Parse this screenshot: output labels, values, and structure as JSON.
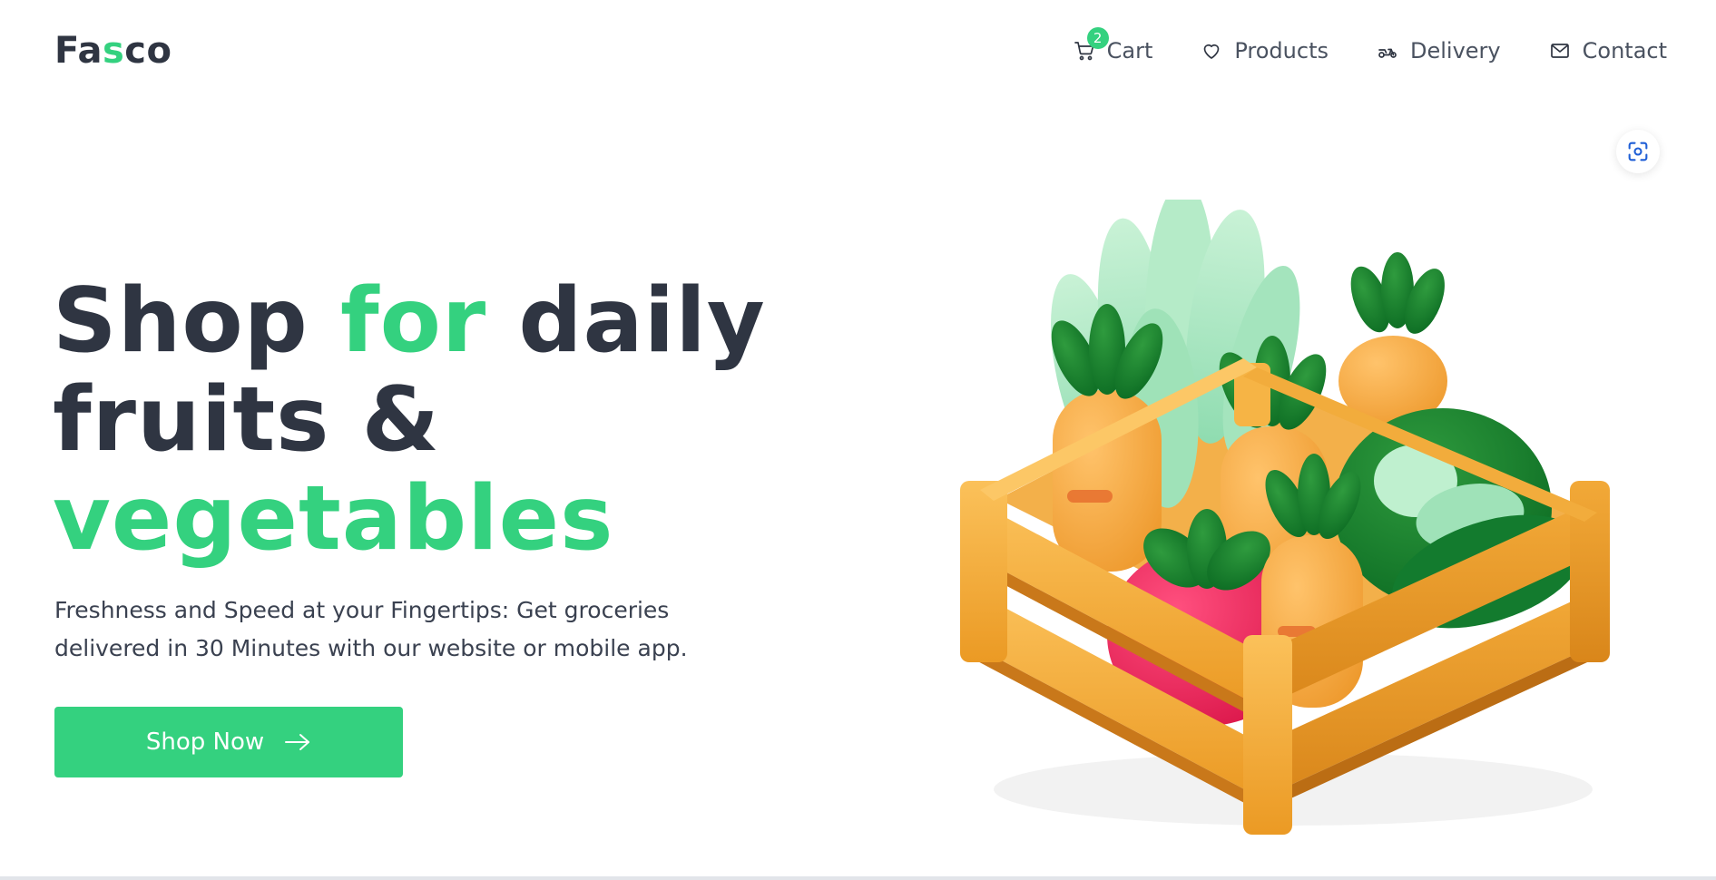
{
  "brand": {
    "logo_part1": "Fa",
    "logo_part2": "s",
    "logo_part3": "co",
    "accent_color": "#34d17f",
    "text_color": "#2f3542"
  },
  "nav": {
    "cart": {
      "label": "Cart",
      "badge": "2",
      "icon": "cart-icon"
    },
    "products": {
      "label": "Products",
      "icon": "heart-icon"
    },
    "delivery": {
      "label": "Delivery",
      "icon": "scooter-icon"
    },
    "contact": {
      "label": "Contact",
      "icon": "mail-icon"
    }
  },
  "scan_button": {
    "icon": "scan-icon"
  },
  "hero": {
    "title_1": "Shop ",
    "title_2": "for",
    "title_3": " daily",
    "title_4": "fruits &",
    "title_5": "vegetables",
    "subtitle_line1": "Freshness and Speed at your Fingertips: Get groceries",
    "subtitle_line2": "delivered in 30 Minutes with our website or mobile app.",
    "cta_label": "Shop Now",
    "cta_icon": "arrow-right-icon",
    "illustration": "vegetable-crate-illustration"
  }
}
